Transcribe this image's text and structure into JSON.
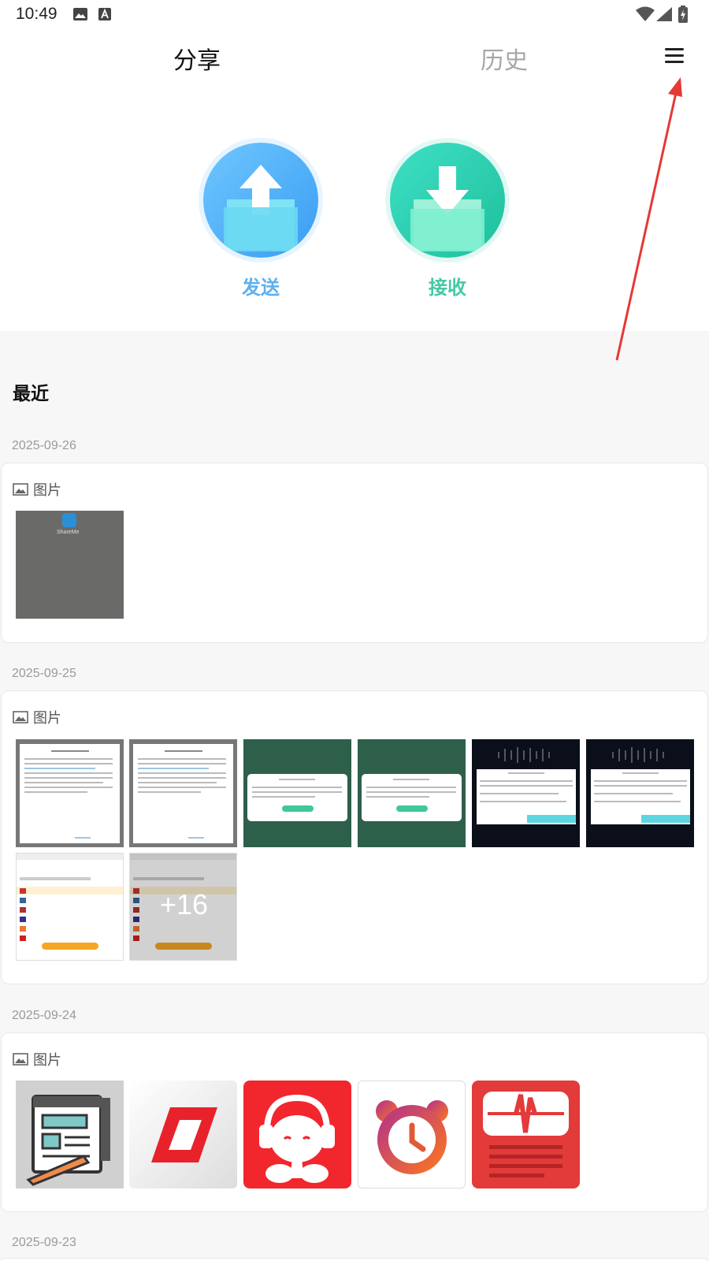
{
  "status_bar": {
    "time": "10:49",
    "icons": [
      "gallery-icon",
      "font-a-icon",
      "wifi-icon",
      "signal-icon",
      "battery-charging-icon"
    ]
  },
  "tabs": [
    {
      "label": "分享",
      "active": true
    },
    {
      "label": "历史",
      "active": false
    }
  ],
  "menu_icon": "hamburger-menu-icon",
  "actions": {
    "send": {
      "label": "发送",
      "icon": "upload-folder-icon",
      "color": "#5cb0f0"
    },
    "receive": {
      "label": "接收",
      "icon": "download-folder-icon",
      "color": "#44c9a6"
    }
  },
  "recent": {
    "title": "最近",
    "groups": [
      {
        "date": "2025-09-26",
        "category": "图片",
        "thumbnails": [
          "screenshot"
        ],
        "thumb_text": "ShareMe"
      },
      {
        "date": "2025-09-25",
        "category": "图片",
        "thumbnails": [
          "screenshot",
          "screenshot",
          "screenshot",
          "screenshot",
          "screenshot",
          "screenshot",
          "screenshot",
          "screenshot"
        ],
        "more_count": "+16"
      },
      {
        "date": "2025-09-24",
        "category": "图片",
        "thumbnails": [
          "notes-app-icon",
          "red-parallelogram-app-icon",
          "elephant-headphones-app-icon",
          "alarm-clock-app-icon",
          "audio-wave-app-icon"
        ]
      },
      {
        "date": "2025-09-23"
      }
    ]
  },
  "annotation": {
    "type": "red-arrow",
    "color": "#e53935"
  }
}
